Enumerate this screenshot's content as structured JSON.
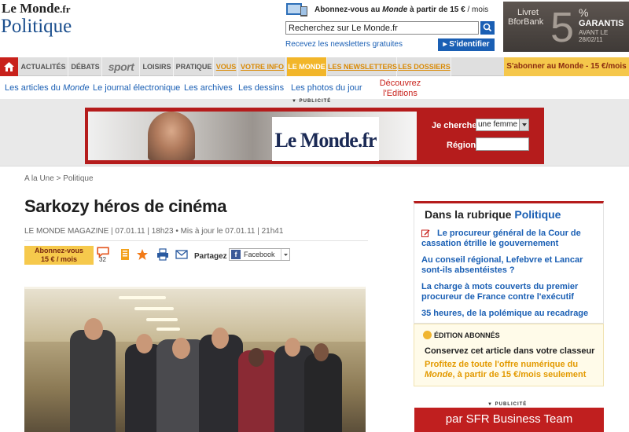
{
  "header": {
    "logo_main": "Le Monde",
    "logo_suffix": ".fr",
    "section_title": "Politique",
    "promo_prefix": "Abonnez-vous au ",
    "promo_italic": "Monde",
    "promo_bold_part": " à partir de 15 €",
    "promo_suffix": " / mois",
    "search_value": "Recherchez sur Le Monde.fr",
    "newsletters_link": "Recevez les newsletters gratuites",
    "login_button": "S'identifier",
    "login_arrow": "▸"
  },
  "bank_ad": {
    "line1": "Livret",
    "line2": "BforBank",
    "big_number": "5",
    "percent": "%",
    "garantis": "GARANTIS",
    "avant": "AVANT LE 28/02/11"
  },
  "nav": {
    "items": [
      {
        "label": "Actualités"
      },
      {
        "label": "Débats"
      },
      {
        "label": "sport"
      },
      {
        "label": "Loisirs"
      },
      {
        "label": "Pratique"
      },
      {
        "label": "Vous"
      },
      {
        "label": "Votre info"
      },
      {
        "label": "Le Monde"
      },
      {
        "label": "Les newsletters"
      },
      {
        "label": "Les dossiers"
      }
    ],
    "subscribe": "S'abonner au Monde - 15 €/mois"
  },
  "subnav": {
    "items": [
      {
        "prefix": "Les articles du ",
        "italic": "Monde"
      },
      {
        "label": "Le journal électronique"
      },
      {
        "label": "Les archives"
      },
      {
        "label": "Les dessins"
      },
      {
        "label": "Les photos du jour"
      }
    ],
    "decouvrez": "Découvrez l'Editions abonnés"
  },
  "ad_band": {
    "label": "PUBLICITÉ",
    "logo_text": "Le Monde.fr",
    "je_cherche": "Je cherche",
    "select_value": "une femme",
    "region_label": "Région"
  },
  "article": {
    "breadcrumb": "A la Une > Politique",
    "headline": "Sarkozy héros de cinéma",
    "byline": "LE MONDE MAGAZINE | 07.01.11 | 18h23  •  Mis à jour le 07.01.11 | 21h41",
    "share_subscribe_line1": "Abonnez-vous",
    "share_subscribe_line2": "15 € / mois",
    "comments_count": "32",
    "partagez": "Partagez",
    "facebook": "Facebook"
  },
  "rubrique": {
    "title_prefix": "Dans la rubrique ",
    "title_section": "Politique",
    "links": [
      {
        "label": "Le procureur général de la Cour de cassation étrille le gouvernement"
      },
      {
        "label": "Au conseil régional, Lefebvre et Lancar sont-ils absentéistes ?"
      },
      {
        "label": "La charge à mots couverts du premier procureur de France contre l'exécutif"
      },
      {
        "label": "35 heures, de la polémique au recadrage"
      }
    ]
  },
  "abonnes": {
    "title": "ÉDITION ABONNÉS",
    "classeur": "Conservez cet article dans votre classeur",
    "offre_prefix": "Profitez de toute l'offre numérique du ",
    "offre_italic": "Monde",
    "offre_suffix": ", à partir de 15 €/mois seulement"
  },
  "right_ad": {
    "label": "PUBLICITÉ",
    "text": "par SFR Business Team"
  },
  "colors": {
    "brand_blue": "#1a5fb4",
    "brand_red": "#c8211b",
    "accent_yellow": "#f2b62a",
    "accent_orange": "#e39a00"
  }
}
